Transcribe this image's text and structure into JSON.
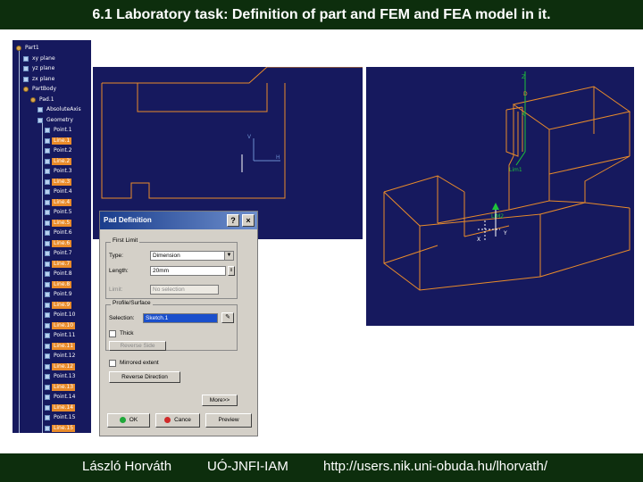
{
  "slide": {
    "title": "6.1 Laboratory task: Definition of part and FEM and FEA model in it."
  },
  "footer": {
    "author": "László Horváth",
    "institute": "UÓ-JNFI-IAM",
    "url": "http://users.nik.uni-obuda.hu/lhorvath/"
  },
  "tree": {
    "items": [
      {
        "label": "Part1",
        "indent": 0,
        "icon": "gear",
        "hl": false
      },
      {
        "label": "xy plane",
        "indent": 1,
        "icon": "plane",
        "hl": false
      },
      {
        "label": "yz plane",
        "indent": 1,
        "icon": "plane",
        "hl": false
      },
      {
        "label": "zx plane",
        "indent": 1,
        "icon": "plane",
        "hl": false
      },
      {
        "label": "PartBody",
        "indent": 1,
        "icon": "gear",
        "hl": false
      },
      {
        "label": "Pad.1",
        "indent": 2,
        "icon": "gear",
        "hl": false
      },
      {
        "label": "AbsoluteAxis",
        "indent": 3,
        "icon": "plane",
        "hl": false
      },
      {
        "label": "Geometry",
        "indent": 3,
        "icon": "plane",
        "hl": false
      },
      {
        "label": "Point.1",
        "indent": 4,
        "icon": "pt",
        "hl": false
      },
      {
        "label": "Line.1",
        "indent": 4,
        "icon": "pt",
        "hl": true
      },
      {
        "label": "Point.2",
        "indent": 4,
        "icon": "pt",
        "hl": false
      },
      {
        "label": "Line.2",
        "indent": 4,
        "icon": "pt",
        "hl": true
      },
      {
        "label": "Point.3",
        "indent": 4,
        "icon": "pt",
        "hl": false
      },
      {
        "label": "Line.3",
        "indent": 4,
        "icon": "pt",
        "hl": true
      },
      {
        "label": "Point.4",
        "indent": 4,
        "icon": "pt",
        "hl": false
      },
      {
        "label": "Line.4",
        "indent": 4,
        "icon": "pt",
        "hl": true
      },
      {
        "label": "Point.5",
        "indent": 4,
        "icon": "pt",
        "hl": false
      },
      {
        "label": "Line.5",
        "indent": 4,
        "icon": "pt",
        "hl": true
      },
      {
        "label": "Point.6",
        "indent": 4,
        "icon": "pt",
        "hl": false
      },
      {
        "label": "Line.6",
        "indent": 4,
        "icon": "pt",
        "hl": true
      },
      {
        "label": "Point.7",
        "indent": 4,
        "icon": "pt",
        "hl": false
      },
      {
        "label": "Line.7",
        "indent": 4,
        "icon": "pt",
        "hl": true
      },
      {
        "label": "Point.8",
        "indent": 4,
        "icon": "pt",
        "hl": false
      },
      {
        "label": "Line.8",
        "indent": 4,
        "icon": "pt",
        "hl": true
      },
      {
        "label": "Point.9",
        "indent": 4,
        "icon": "pt",
        "hl": false
      },
      {
        "label": "Line.9",
        "indent": 4,
        "icon": "pt",
        "hl": true
      },
      {
        "label": "Point.10",
        "indent": 4,
        "icon": "pt",
        "hl": false
      },
      {
        "label": "Line.10",
        "indent": 4,
        "icon": "pt",
        "hl": true
      },
      {
        "label": "Point.11",
        "indent": 4,
        "icon": "pt",
        "hl": false
      },
      {
        "label": "Line.11",
        "indent": 4,
        "icon": "pt",
        "hl": true
      },
      {
        "label": "Point.12",
        "indent": 4,
        "icon": "pt",
        "hl": false
      },
      {
        "label": "Line.12",
        "indent": 4,
        "icon": "pt",
        "hl": true
      },
      {
        "label": "Point.13",
        "indent": 4,
        "icon": "pt",
        "hl": false
      },
      {
        "label": "Line.13",
        "indent": 4,
        "icon": "pt",
        "hl": true
      },
      {
        "label": "Point.14",
        "indent": 4,
        "icon": "pt",
        "hl": false
      },
      {
        "label": "Line.14",
        "indent": 4,
        "icon": "pt",
        "hl": true
      },
      {
        "label": "Point.15",
        "indent": 4,
        "icon": "pt",
        "hl": false
      },
      {
        "label": "Line.15",
        "indent": 4,
        "icon": "pt",
        "hl": true
      },
      {
        "label": "Pad.1",
        "indent": 3,
        "icon": "gear",
        "hl": false
      }
    ]
  },
  "sketch": {
    "axis_v": "V",
    "axis_h": "H"
  },
  "view3d": {
    "label_top": "Z",
    "label_d": "D",
    "label_x": "X",
    "label_lim1": "Lim1",
    "label_lim2": "LIM2",
    "label_y": "Y",
    "label_xy": "X"
  },
  "dialog": {
    "title": "Pad Definition",
    "help_btn": "?",
    "close_btn": "×",
    "first_limit_group": "First Limit",
    "type_label": "Type:",
    "type_value": "Dimension",
    "length_label": "Length:",
    "length_value": "20mm",
    "limit_label": "Limit:",
    "limit_value": "No selection",
    "profile_group": "Profile/Surface",
    "selection_label": "Selection:",
    "selection_value": "Sketch.1",
    "thick_label": "Thick",
    "reverse_side_btn": "Reverse Side",
    "mirrored_label": "Mirrored extent",
    "reverse_dir_btn": "Reverse Direction",
    "more_btn": "More>>",
    "ok_btn": "OK",
    "cancel_btn": "Cance",
    "preview_btn": "Preview"
  },
  "colors": {
    "background_dark_green": "#0d2e0d",
    "viewport_navy": "#16195e",
    "geometry_orange": "#e98b2a",
    "highlight_orange": "#e98b2a"
  }
}
